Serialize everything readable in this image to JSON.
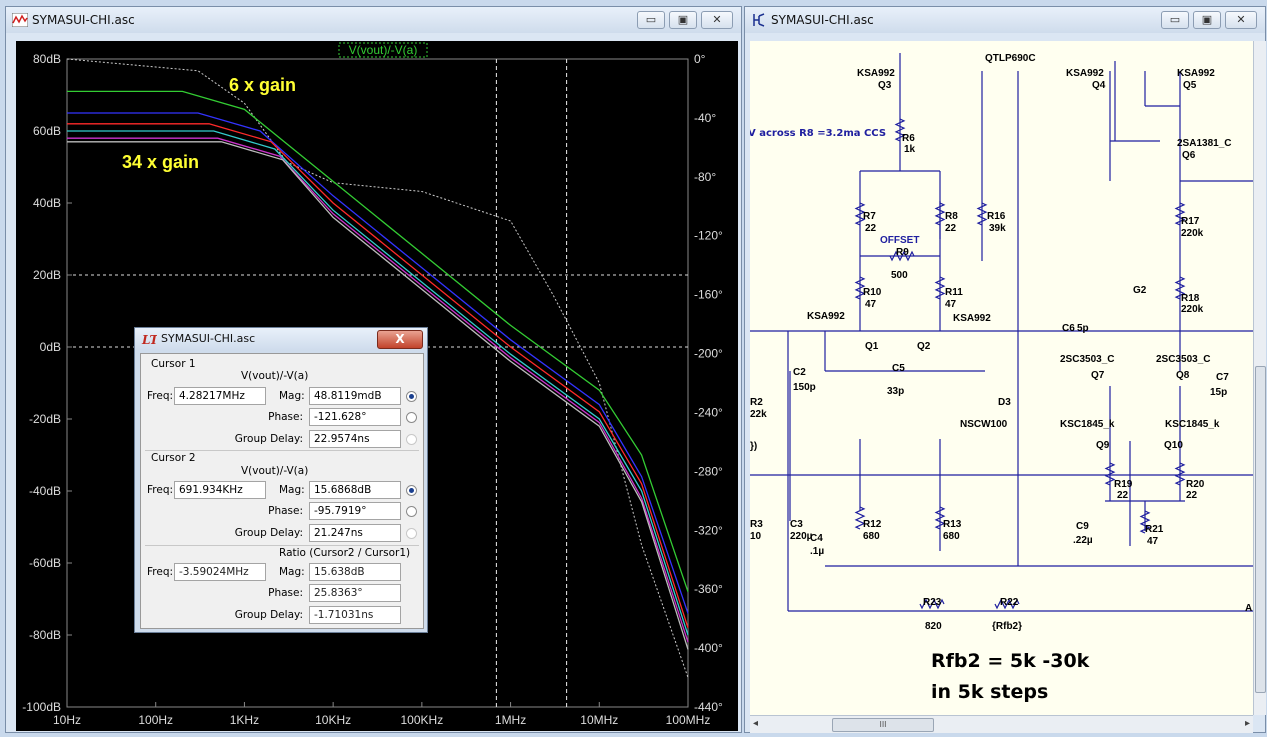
{
  "left_window": {
    "title": "SYMASUI-CHI.asc",
    "trace_label": "V(vout)/-V(a)",
    "annotations": [
      "6 x gain",
      "34 x gain"
    ],
    "y_left_ticks": [
      "80dB",
      "60dB",
      "40dB",
      "20dB",
      "0dB",
      "-20dB",
      "-40dB",
      "-60dB",
      "-80dB",
      "-100dB"
    ],
    "y_right_ticks": [
      "0°",
      "-40°",
      "-80°",
      "-120°",
      "-160°",
      "-200°",
      "-240°",
      "-280°",
      "-320°",
      "-360°",
      "-400°",
      "-440°"
    ],
    "x_ticks": [
      "10Hz",
      "100Hz",
      "1KHz",
      "10KHz",
      "100KHz",
      "1MHz",
      "10MHz",
      "100MHz"
    ]
  },
  "right_window": {
    "title": "SYMASUI-CHI.asc",
    "note_line1": "Rfb2 = 5k -30k",
    "note_line2": "in 5k steps",
    "ccs_note": "V across R8 =3.2ma CCS",
    "scroll_thumb": "III",
    "labels": [
      {
        "t": "QTLP690C"
      },
      {
        "t": "KSA992"
      },
      {
        "t": "Q3"
      },
      {
        "t": "KSA992"
      },
      {
        "t": "Q4"
      },
      {
        "t": "KSA992"
      },
      {
        "t": "Q5"
      },
      {
        "t": "R6"
      },
      {
        "t": "1k"
      },
      {
        "t": "2SA1381_C"
      },
      {
        "t": "Q6"
      },
      {
        "t": "R7"
      },
      {
        "t": "22"
      },
      {
        "t": "R8"
      },
      {
        "t": "22"
      },
      {
        "t": "R16"
      },
      {
        "t": "39k"
      },
      {
        "t": "R17"
      },
      {
        "t": "220k"
      },
      {
        "t": "OFFSET"
      },
      {
        "t": "R9"
      },
      {
        "t": "500"
      },
      {
        "t": "G2"
      },
      {
        "t": "R10"
      },
      {
        "t": "47"
      },
      {
        "t": "R11"
      },
      {
        "t": "47"
      },
      {
        "t": "R18"
      },
      {
        "t": "220k"
      },
      {
        "t": "KSA992"
      },
      {
        "t": "KSA992"
      },
      {
        "t": "Q1"
      },
      {
        "t": "Q2"
      },
      {
        "t": "C6"
      },
      {
        "t": "5p"
      },
      {
        "t": "C2"
      },
      {
        "t": "150p"
      },
      {
        "t": "C5"
      },
      {
        "t": "33p"
      },
      {
        "t": "2SC3503_C"
      },
      {
        "t": "2SC3503_C"
      },
      {
        "t": "Q7"
      },
      {
        "t": "Q8"
      },
      {
        "t": "C7"
      },
      {
        "t": "15p"
      },
      {
        "t": "R2"
      },
      {
        "t": "22k"
      },
      {
        "t": "D3"
      },
      {
        "t": "NSCW100"
      },
      {
        "t": "KSC1845_k"
      },
      {
        "t": "KSC1845_k"
      },
      {
        "t": "Q9"
      },
      {
        "t": "Q10"
      },
      {
        "t": "})"
      },
      {
        "t": "R19"
      },
      {
        "t": "22"
      },
      {
        "t": "R20"
      },
      {
        "t": "22"
      },
      {
        "t": "R3"
      },
      {
        "t": "10"
      },
      {
        "t": "C3"
      },
      {
        "t": "220µ"
      },
      {
        "t": "C4"
      },
      {
        "t": ".1µ"
      },
      {
        "t": "R12"
      },
      {
        "t": "680"
      },
      {
        "t": "R13"
      },
      {
        "t": "680"
      },
      {
        "t": "C9"
      },
      {
        "t": ".22µ"
      },
      {
        "t": "R21"
      },
      {
        "t": "47"
      },
      {
        "t": "R23"
      },
      {
        "t": "820"
      },
      {
        "t": "R22"
      },
      {
        "t": "{Rfb2}"
      },
      {
        "t": "A"
      }
    ]
  },
  "cursor_dialog": {
    "title": "SYMASUI-CHI.asc",
    "close": "X",
    "c1": {
      "section": "Cursor 1",
      "expr": "V(vout)/-V(a)",
      "freq_label": "Freq:",
      "freq": "4.28217MHz",
      "mag_label": "Mag:",
      "mag": "48.8119mdB",
      "phase_label": "Phase:",
      "phase": "-121.628°",
      "gd_label": "Group Delay:",
      "gd": "22.9574ns"
    },
    "c2": {
      "section": "Cursor 2",
      "expr": "V(vout)/-V(a)",
      "freq_label": "Freq:",
      "freq": "691.934KHz",
      "mag_label": "Mag:",
      "mag": "15.6868dB",
      "phase_label": "Phase:",
      "phase": "-95.7919°",
      "gd_label": "Group Delay:",
      "gd": "21.247ns"
    },
    "ratio": {
      "section": "Ratio (Cursor2 / Cursor1)",
      "freq_label": "Freq:",
      "freq": "-3.59024MHz",
      "mag_label": "Mag:",
      "mag": "15.638dB",
      "phase_label": "Phase:",
      "phase": "25.8363°",
      "gd_label": "Group Delay:",
      "gd": "-1.71031ns"
    }
  },
  "chart_data": {
    "type": "line",
    "x_scale": "log",
    "xlim": [
      10,
      100000000
    ],
    "ylim": [
      -100,
      80
    ],
    "y2lim": [
      -440,
      0
    ],
    "xlabel": "",
    "ylabel": "",
    "series": [
      {
        "name": "V(vout)/-V(a)",
        "color": "#33cc33",
        "points": [
          [
            10,
            71
          ],
          [
            200,
            71
          ],
          [
            1000,
            66
          ],
          [
            10000,
            46
          ],
          [
            100000,
            26
          ],
          [
            1000000,
            6
          ],
          [
            10000000,
            -12
          ],
          [
            30000000,
            -30
          ],
          [
            100000000,
            -68
          ]
        ]
      },
      {
        "color": "#3333ff",
        "points": [
          [
            10,
            65
          ],
          [
            300,
            65
          ],
          [
            1500,
            60
          ],
          [
            10000,
            42
          ],
          [
            100000,
            22
          ],
          [
            1000000,
            2
          ],
          [
            10000000,
            -16
          ],
          [
            30000000,
            -36
          ],
          [
            100000000,
            -74
          ]
        ]
      },
      {
        "color": "#ff2a2a",
        "points": [
          [
            10,
            62
          ],
          [
            400,
            62
          ],
          [
            2000,
            57
          ],
          [
            10000,
            40
          ],
          [
            100000,
            20
          ],
          [
            1000000,
            0
          ],
          [
            10000000,
            -18
          ],
          [
            30000000,
            -38
          ],
          [
            100000000,
            -78
          ]
        ]
      },
      {
        "color": "#33cccc",
        "points": [
          [
            10,
            60
          ],
          [
            450,
            60
          ],
          [
            2200,
            55
          ],
          [
            10000,
            38
          ],
          [
            100000,
            18
          ],
          [
            1000000,
            -2
          ],
          [
            10000000,
            -20
          ],
          [
            30000000,
            -40
          ],
          [
            100000000,
            -80
          ]
        ]
      },
      {
        "color": "#cc33cc",
        "points": [
          [
            10,
            58
          ],
          [
            500,
            58
          ],
          [
            2500,
            53
          ],
          [
            10000,
            37
          ],
          [
            100000,
            17
          ],
          [
            1000000,
            -3
          ],
          [
            10000000,
            -21
          ],
          [
            30000000,
            -42
          ],
          [
            100000000,
            -82
          ]
        ]
      },
      {
        "color": "#bbbbbb",
        "points": [
          [
            10,
            57
          ],
          [
            550,
            57
          ],
          [
            2700,
            52
          ],
          [
            10000,
            36
          ],
          [
            100000,
            16
          ],
          [
            1000000,
            -4
          ],
          [
            10000000,
            -22
          ],
          [
            30000000,
            -43
          ],
          [
            100000000,
            -84
          ]
        ]
      }
    ],
    "phase_series": {
      "color": "#cccccc",
      "axis": "right",
      "points": [
        [
          10,
          0
        ],
        [
          300,
          -8
        ],
        [
          1000,
          -30
        ],
        [
          3000,
          -70
        ],
        [
          10000,
          -84
        ],
        [
          100000,
          -90
        ],
        [
          1000000,
          -110
        ],
        [
          3000000,
          -160
        ],
        [
          10000000,
          -220
        ],
        [
          30000000,
          -330
        ],
        [
          100000000,
          -420
        ]
      ]
    },
    "cursors_x": [
      691934,
      4282170
    ],
    "grid": true
  }
}
